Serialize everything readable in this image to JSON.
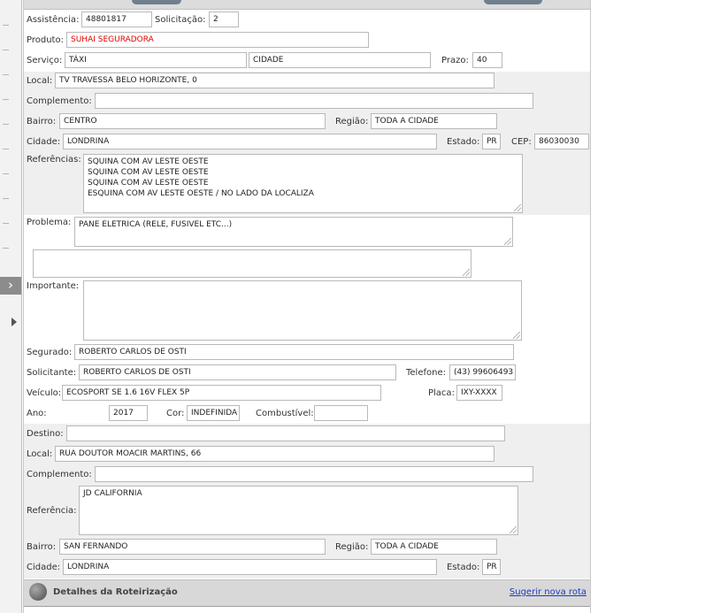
{
  "form": {
    "assistencia": {
      "label": "Assistência:",
      "value": "48801817"
    },
    "solicitacao": {
      "label": "Solicitação:",
      "value": "2"
    },
    "produto": {
      "label": "Produto:",
      "value": "SUHAI SEGURADORA"
    },
    "servico": {
      "label": "Serviço:",
      "value": "TÁXI",
      "value2": "CIDADE"
    },
    "prazo": {
      "label": "Prazo:",
      "value": "40"
    },
    "origem": {
      "local": {
        "label": "Local:",
        "value": "TV TRAVESSA BELO HORIZONTE, 0"
      },
      "complemento": {
        "label": "Complemento:",
        "value": ""
      },
      "bairro": {
        "label": "Bairro:",
        "value": "CENTRO"
      },
      "regiao": {
        "label": "Região:",
        "value": "TODA A CIDADE"
      },
      "cidade": {
        "label": "Cidade:",
        "value": "LONDRINA"
      },
      "estado": {
        "label": "Estado:",
        "value": "PR"
      },
      "cep": {
        "label": "CEP:",
        "value": "86030030"
      },
      "referencias": {
        "label": "Referências:",
        "lines": [
          "SQUINA COM AV LESTE OESTE",
          "SQUINA COM AV LESTE OESTE",
          "SQUINA COM AV LESTE OESTE",
          "ESQUINA COM AV LESTE OESTE / NO LADO DA LOCALIZA"
        ]
      }
    },
    "problema": {
      "label": "Problema:",
      "value": "PANE ELETRICA (RELE, FUSIVEL ETC...)"
    },
    "extra_notes": {
      "value": ""
    },
    "importante": {
      "label": "Importante:",
      "value": ""
    },
    "segurado": {
      "label": "Segurado:",
      "value": "ROBERTO CARLOS DE OSTI"
    },
    "solicitante": {
      "label": "Solicitante:",
      "value": "ROBERTO CARLOS DE OSTI"
    },
    "telefone": {
      "label": "Telefone:",
      "value": "(43) 99606493"
    },
    "veiculo": {
      "label": "Veículo:",
      "value": "ECOSPORT SE 1.6 16V FLEX 5P"
    },
    "placa": {
      "label": "Placa:",
      "value": "IXY-XXXX"
    },
    "ano": {
      "label": "Ano:",
      "value": "2017"
    },
    "cor": {
      "label": "Cor:",
      "value": "INDEFINIDA"
    },
    "combustivel": {
      "label": "Combustível:",
      "value": ""
    },
    "destino_section": {
      "destino": {
        "label": "Destino:",
        "value": ""
      },
      "local": {
        "label": "Local:",
        "value": "RUA DOUTOR MOACIR MARTINS, 66"
      },
      "complemento": {
        "label": "Complemento:",
        "value": ""
      },
      "referencia": {
        "label": "Referência:",
        "value": "JD CALIFORNIA"
      },
      "bairro": {
        "label": "Bairro:",
        "value": "SAN FERNANDO"
      },
      "regiao": {
        "label": "Região:",
        "value": "TODA A CIDADE"
      },
      "cidade": {
        "label": "Cidade:",
        "value": "LONDRINA"
      },
      "estado": {
        "label": "Estado:",
        "value": "PR"
      }
    }
  },
  "footer": {
    "title": "Detalhes da Roteirização",
    "link": "Sugerir nova rota",
    "icon": "globe-icon"
  },
  "colors": {
    "band": "#efefef",
    "link": "#1a3cc8",
    "product_text": "#e30000",
    "footer_bg": "#d8d8d8"
  }
}
